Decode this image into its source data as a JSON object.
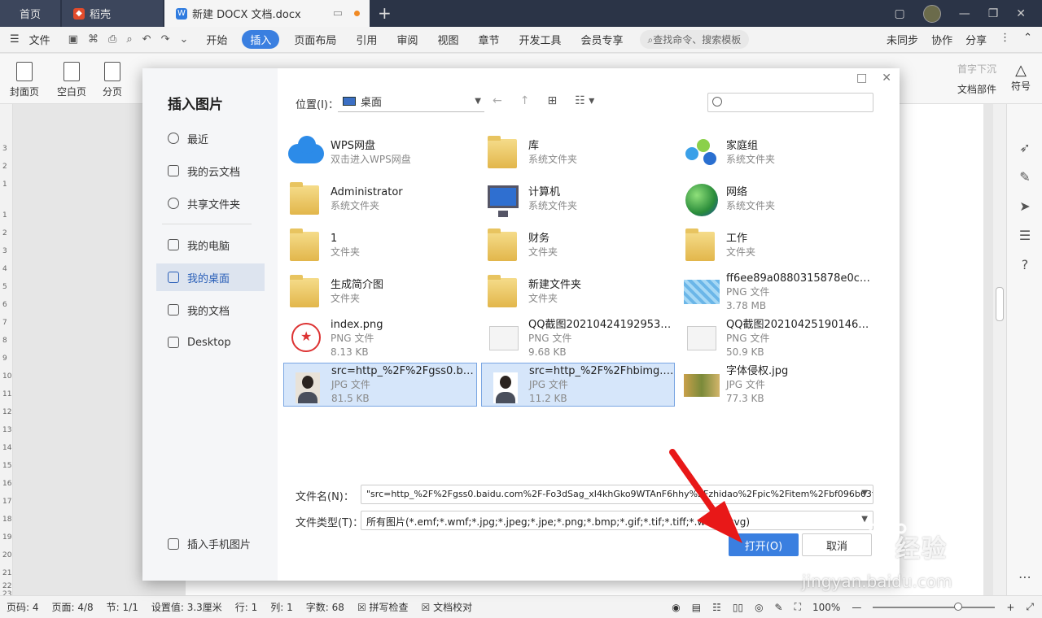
{
  "titlebar": {
    "tabs": [
      {
        "label": "首页"
      },
      {
        "label": "稻壳"
      },
      {
        "label": "新建 DOCX 文档.docx"
      }
    ]
  },
  "menubar": {
    "file": "文件",
    "items": [
      "开始",
      "插入",
      "页面布局",
      "引用",
      "审阅",
      "视图",
      "章节",
      "开发工具",
      "会员专享"
    ],
    "active": "插入",
    "search_placeholder": "查找命令、搜索模板",
    "right": [
      "未同步",
      "协作",
      "分享"
    ]
  },
  "ribbon": {
    "buttons": [
      "封面页",
      "空白页",
      "分页"
    ],
    "right_labels": [
      "首字下沉",
      "文档部件",
      "符号"
    ]
  },
  "left_ruler": [
    "3",
    "2",
    "1",
    "1",
    "2",
    "3",
    "4",
    "5",
    "6",
    "7",
    "8",
    "9",
    "10",
    "11",
    "12",
    "13",
    "14",
    "15",
    "16",
    "17",
    "18",
    "19",
    "20",
    "21",
    "22",
    "23"
  ],
  "dialog": {
    "title": "插入图片",
    "nav": [
      "最近",
      "我的云文档",
      "共享文件夹",
      "我的电脑",
      "我的桌面",
      "我的文档",
      "Desktop"
    ],
    "nav_active": "我的桌面",
    "nav_bottom": "插入手机图片",
    "location_label": "位置(I)：",
    "location_value": "桌面",
    "files": [
      {
        "name": "WPS网盘",
        "sub": "双击进入WPS网盘",
        "size": "",
        "thumb": "cloud"
      },
      {
        "name": "库",
        "sub": "系统文件夹",
        "size": "",
        "thumb": "folder"
      },
      {
        "name": "家庭组",
        "sub": "系统文件夹",
        "size": "",
        "thumb": "people"
      },
      {
        "name": "Administrator",
        "sub": "系统文件夹",
        "size": "",
        "thumb": "folder"
      },
      {
        "name": "计算机",
        "sub": "系统文件夹",
        "size": "",
        "thumb": "pc"
      },
      {
        "name": "网络",
        "sub": "系统文件夹",
        "size": "",
        "thumb": "globe"
      },
      {
        "name": "1",
        "sub": "文件夹",
        "size": "",
        "thumb": "folder"
      },
      {
        "name": "财务",
        "sub": "文件夹",
        "size": "",
        "thumb": "folder"
      },
      {
        "name": "工作",
        "sub": "文件夹",
        "size": "",
        "thumb": "folder"
      },
      {
        "name": "生成简介图",
        "sub": "文件夹",
        "size": "",
        "thumb": "folder"
      },
      {
        "name": "新建文件夹",
        "sub": "文件夹",
        "size": "",
        "thumb": "folder"
      },
      {
        "name": "ff6ee89a0880315878e0c0a33...",
        "sub": "PNG 文件",
        "size": "3.78 MB",
        "thumb": "water"
      },
      {
        "name": "index.png",
        "sub": "PNG 文件",
        "size": "8.13 KB",
        "thumb": "seal"
      },
      {
        "name": "QQ截图20210424192953.png",
        "sub": "PNG 文件",
        "size": "9.68 KB",
        "thumb": "doc"
      },
      {
        "name": "QQ截图20210425190146.png",
        "sub": "PNG 文件",
        "size": "50.9 KB",
        "thumb": "doc"
      },
      {
        "name": "src=http_%2F%2Fgss0.baidu....",
        "sub": "JPG 文件",
        "size": "81.5 KB",
        "thumb": "person",
        "selected": true
      },
      {
        "name": "src=http_%2F%2Fhbimg.hua...",
        "sub": "JPG 文件",
        "size": "11.2 KB",
        "thumb": "person",
        "selected": true
      },
      {
        "name": "字体侵权.jpg",
        "sub": "JPG 文件",
        "size": "77.3 KB",
        "thumb": "img"
      }
    ],
    "filename_label": "文件名(N)：",
    "filename_value": "\"src=http_%2F%2Fgss0.baidu.com%2F-Fo3dSag_xI4khGko9WTAnF6hhy%2Fzhidao%2Fpic%2Fitem%2Fbf096b63f6246b60",
    "filetype_label": "文件类型(T)：",
    "filetype_value": "所有图片(*.emf;*.wmf;*.jpg;*.jpeg;*.jpe;*.png;*.bmp;*.gif;*.tif;*.tiff;*.wdp;*.svg)",
    "open_label": "打开(O)",
    "cancel_label": "取消"
  },
  "statusbar": {
    "items": [
      "页码: 4",
      "页面: 4/8",
      "节: 1/1",
      "设置值: 3.3厘米",
      "行: 1",
      "列: 1",
      "字数: 68",
      "拼写检查",
      "文档校对"
    ],
    "zoom": "100%"
  },
  "watermark": {
    "brand": "经验",
    "url": "jingyan.baidu.com"
  },
  "colors": {
    "accent": "#3a7fe0",
    "titlebar": "#2b3447",
    "arrow": "#e81818"
  }
}
